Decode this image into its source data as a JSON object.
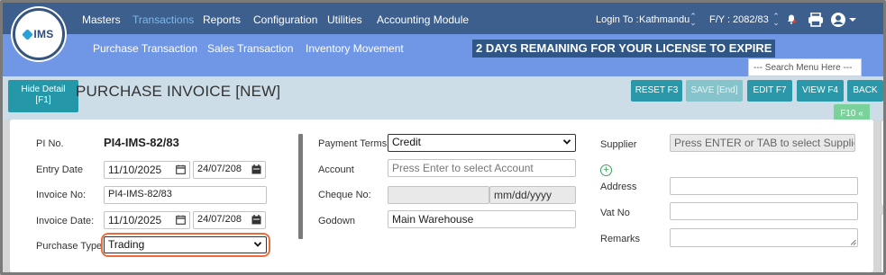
{
  "logo": {
    "text": "IMS"
  },
  "nav": {
    "items": [
      "Masters",
      "Transactions",
      "Reports",
      "Configuration",
      "Utilities",
      "Accounting Module"
    ],
    "active": "Transactions"
  },
  "subnav": {
    "items": [
      "Purchase Transaction",
      "Sales Transaction",
      "Inventory Movement"
    ]
  },
  "license_banner": "2 DAYS REMAINING FOR YOUR LICENSE TO EXPIRE",
  "login": {
    "label": "Login To :",
    "location": "Kathmandu",
    "fy_label": "F/Y :",
    "fy_value": "2082/83"
  },
  "menu_search": {
    "placeholder": "--- Search Menu Here ---"
  },
  "toolbar": {
    "hide_detail_line1": "Hide Detail",
    "hide_detail_line2": "[F1]",
    "title": "PURCHASE INVOICE [NEW]",
    "reset": "RESET F3",
    "save": "SAVE [End]",
    "edit": "EDIT F7",
    "view": "VIEW F4",
    "back": "BACK",
    "f10": "F10 «"
  },
  "form": {
    "pi_no_label": "PI No.",
    "pi_no_value": "PI4-IMS-82/83",
    "entry_date_label": "Entry Date",
    "entry_date_ad": "11/10/2025",
    "entry_date_bs": "24/07/208",
    "invoice_no_label": "Invoice No:",
    "invoice_no_value": "PI4-IMS-82/83",
    "invoice_date_label": "Invoice Date:",
    "invoice_date_ad": "11/10/2025",
    "invoice_date_bs": "24/07/208",
    "purchase_type_label": "Purchase Type",
    "purchase_type_value": "Trading",
    "payment_terms_label": "Payment Terms",
    "payment_terms_value": "Credit",
    "account_label": "Account",
    "account_placeholder": "Press Enter to select Account",
    "cheque_no_label": "Cheque No:",
    "cheque_date_placeholder": "mm/dd/yyyy",
    "godown_label": "Godown",
    "godown_value": "Main Warehouse",
    "supplier_label": "Supplier",
    "supplier_placeholder": "Press ENTER or TAB to select Supplier",
    "address_label": "Address",
    "vat_no_label": "Vat No",
    "remarks_label": "Remarks"
  },
  "colors": {
    "nav_bg": "#3c5f8d",
    "subnav_bg": "#6f97e5",
    "button": "#2a98a8",
    "highlight": "#ef6b3c"
  }
}
